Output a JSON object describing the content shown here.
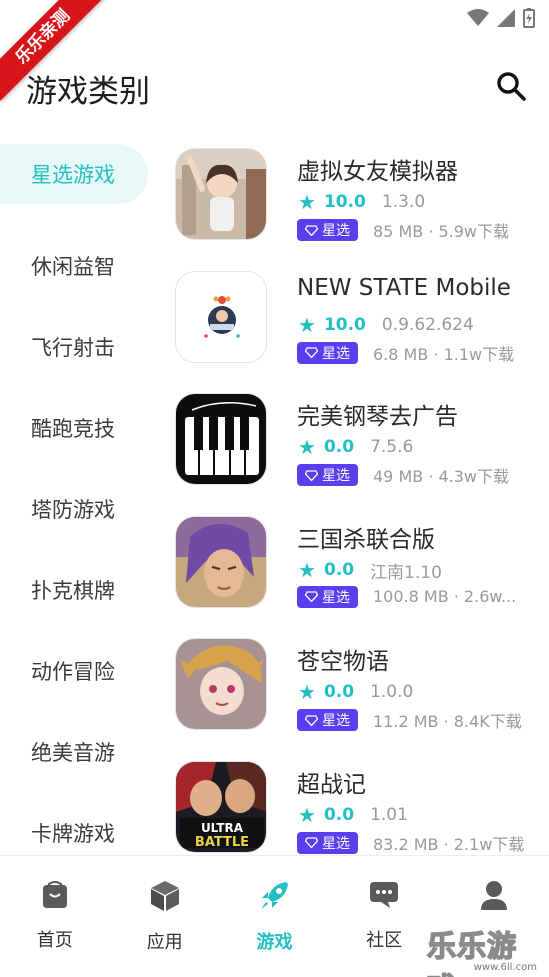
{
  "banner": {
    "text": "乐乐亲测"
  },
  "header": {
    "title": "游戏类别"
  },
  "colors": {
    "accent": "#22bfc3",
    "badge": "#5b3ef0",
    "banner": "#d8141b"
  },
  "sidebar": {
    "items": [
      {
        "label": "星选游戏",
        "active": true
      },
      {
        "label": "休闲益智"
      },
      {
        "label": "飞行射击"
      },
      {
        "label": "酷跑竞技"
      },
      {
        "label": "塔防游戏"
      },
      {
        "label": "扑克棋牌"
      },
      {
        "label": "动作冒险"
      },
      {
        "label": "绝美音游"
      },
      {
        "label": "卡牌游戏"
      }
    ]
  },
  "apps": [
    {
      "name": "虚拟女友模拟器",
      "score": "10.0",
      "version": "1.3.0",
      "badge": "星选",
      "size_downloads": "85 MB · 5.9w下载"
    },
    {
      "name": "NEW STATE Mobile",
      "score": "10.0",
      "version": "0.9.62.624",
      "badge": "星选",
      "size_downloads": "6.8 MB · 1.1w下载"
    },
    {
      "name": "完美钢琴去广告",
      "score": "0.0",
      "version": "7.5.6",
      "badge": "星选",
      "size_downloads": "49 MB · 4.3w下载"
    },
    {
      "name": "三国杀联合版",
      "score": "0.0",
      "version": "江南1.10",
      "badge": "星选",
      "size_downloads": "100.8 MB · 2.6w..."
    },
    {
      "name": "苍空物语",
      "score": "0.0",
      "version": "1.0.0",
      "badge": "星选",
      "size_downloads": "11.2 MB · 8.4K下载"
    },
    {
      "name": "超战记",
      "score": "0.0",
      "version": "1.01",
      "badge": "星选",
      "size_downloads": "83.2 MB · 2.1w下载"
    }
  ],
  "tabbar": {
    "tabs": [
      {
        "label": "首页",
        "icon": "bag-icon"
      },
      {
        "label": "应用",
        "icon": "cube-icon"
      },
      {
        "label": "游戏",
        "icon": "rocket-icon",
        "active": true
      },
      {
        "label": "社区",
        "icon": "chat-icon"
      },
      {
        "label": "",
        "icon": "person-icon"
      }
    ]
  },
  "watermark": {
    "text": "乐乐游戏",
    "url": "www.6ll.com"
  }
}
